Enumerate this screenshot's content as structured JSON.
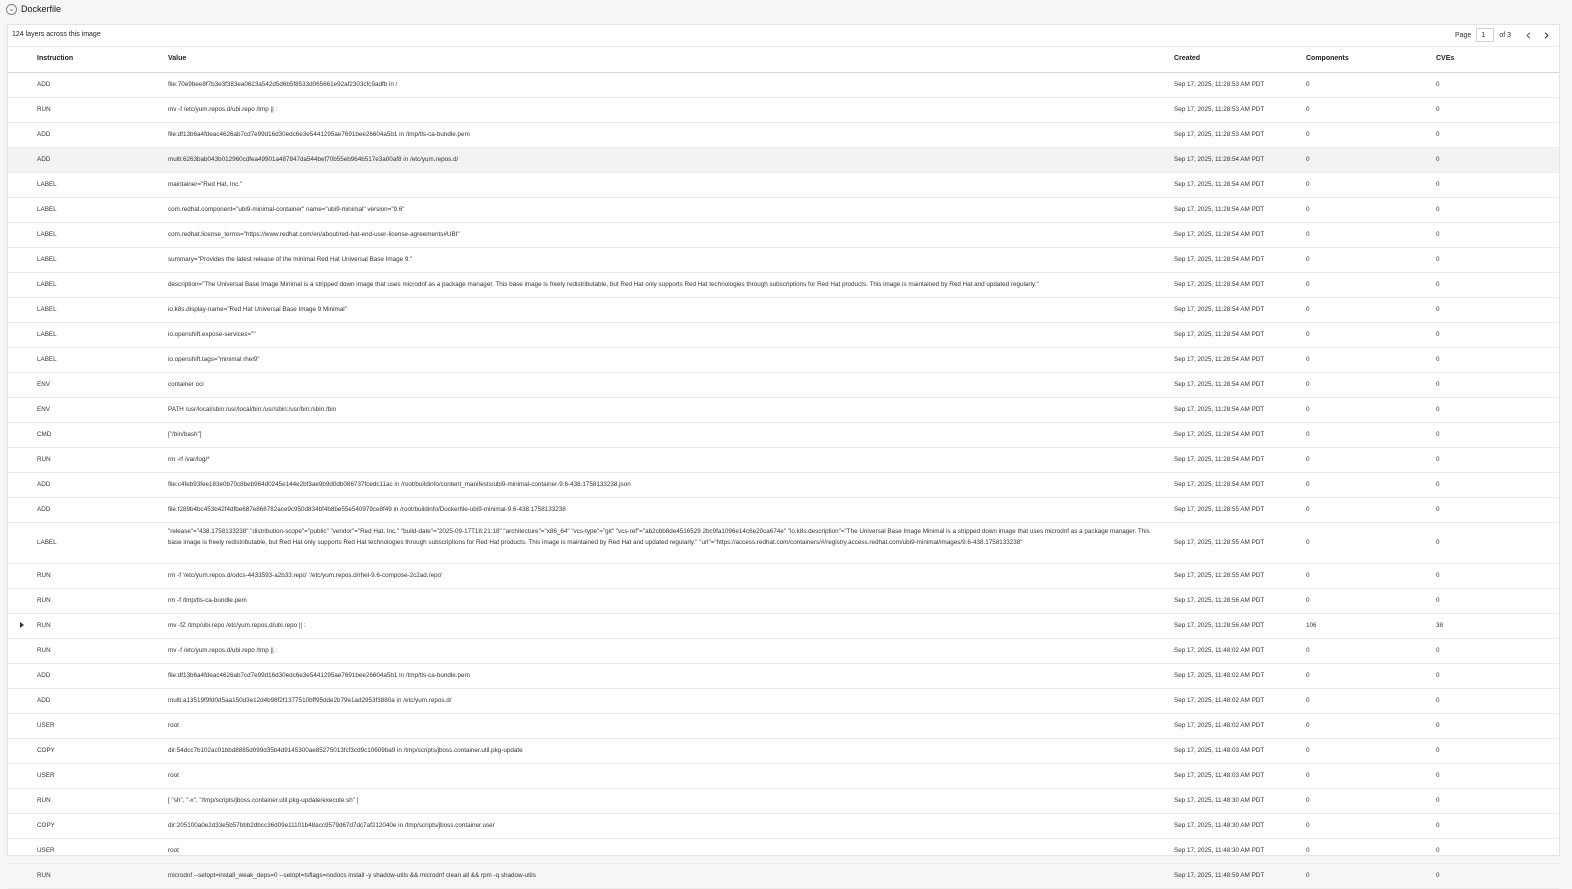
{
  "section": {
    "title": "Dockerfile",
    "toggle_icon": "chevron-down-icon"
  },
  "toolbar": {
    "layer_count": "124 layers across this image",
    "page_label": "Page",
    "page_value": "1",
    "page_total": "of 3"
  },
  "columns": {
    "instruction": "Instruction",
    "value": "Value",
    "created": "Created",
    "components": "Components",
    "cves": "CVEs"
  },
  "rows": [
    {
      "instruction": "ADD",
      "value": "file:70e9bee8f7b3e3f383ea0623a542d5d6b5f8533d065661e92af2303cfc9adfb in /",
      "created": "Sep 17, 2025, 11:28:53 AM PDT",
      "components": "0",
      "cves": "0"
    },
    {
      "instruction": "RUN",
      "value": "mv -f /etc/yum.repos.d/ubi.repo /tmp || :",
      "created": "Sep 17, 2025, 11:28:53 AM PDT",
      "components": "0",
      "cves": "0"
    },
    {
      "instruction": "ADD",
      "value": "file:df13b6a4fdeac4626ab7cd7e99d16d30edc6e3e5441295ae7691bee26604a5b1 in /tmp/tls-ca-bundle.pem",
      "created": "Sep 17, 2025, 11:28:53 AM PDT",
      "components": "0",
      "cves": "0"
    },
    {
      "instruction": "ADD",
      "value": "multi:6263bab043b012960cdfea49901a487847da544bef70b55eb964b517e3a00af8 in /etc/yum.repos.d/",
      "created": "Sep 17, 2025, 11:28:54 AM PDT",
      "components": "0",
      "cves": "0",
      "highlight": true
    },
    {
      "instruction": "LABEL",
      "value": "maintainer=\"Red Hat, Inc.\"",
      "created": "Sep 17, 2025, 11:28:54 AM PDT",
      "components": "0",
      "cves": "0"
    },
    {
      "instruction": "LABEL",
      "value": "com.redhat.component=\"ubi9-minimal-container\" name=\"ubi9-minimal\" version=\"9.6\"",
      "created": "Sep 17, 2025, 11:28:54 AM PDT",
      "components": "0",
      "cves": "0"
    },
    {
      "instruction": "LABEL",
      "value": "com.redhat.license_terms=\"https://www.redhat.com/en/about/red-hat-end-user-license-agreements#UBI\"",
      "created": "Sep 17, 2025, 11:28:54 AM PDT",
      "components": "0",
      "cves": "0"
    },
    {
      "instruction": "LABEL",
      "value": "summary=\"Provides the latest release of the minimal Red Hat Universal Base Image 9.\"",
      "created": "Sep 17, 2025, 11:28:54 AM PDT",
      "components": "0",
      "cves": "0"
    },
    {
      "instruction": "LABEL",
      "value": "description=\"The Universal Base Image Minimal is a stripped down image that uses microdnf as a package manager. This base image is freely redistributable, but Red Hat only supports Red Hat technologies through subscriptions for Red Hat products. This image is maintained by Red Hat and updated regularly.\"",
      "created": "Sep 17, 2025, 11:28:54 AM PDT",
      "components": "0",
      "cves": "0"
    },
    {
      "instruction": "LABEL",
      "value": "io.k8s.display-name=\"Red Hat Universal Base Image 9 Minimal\"",
      "created": "Sep 17, 2025, 11:28:54 AM PDT",
      "components": "0",
      "cves": "0"
    },
    {
      "instruction": "LABEL",
      "value": "io.openshift.expose-services=\"\"",
      "created": "Sep 17, 2025, 11:28:54 AM PDT",
      "components": "0",
      "cves": "0"
    },
    {
      "instruction": "LABEL",
      "value": "io.openshift.tags=\"minimal rhel9\"",
      "created": "Sep 17, 2025, 11:28:54 AM PDT",
      "components": "0",
      "cves": "0"
    },
    {
      "instruction": "ENV",
      "value": "container oci",
      "created": "Sep 17, 2025, 11:28:54 AM PDT",
      "components": "0",
      "cves": "0"
    },
    {
      "instruction": "ENV",
      "value": "PATH /usr/local/sbin:/usr/local/bin:/usr/sbin:/usr/bin:/sbin:/bin",
      "created": "Sep 17, 2025, 11:28:54 AM PDT",
      "components": "0",
      "cves": "0"
    },
    {
      "instruction": "CMD",
      "value": "[\"/bin/bash\"]",
      "created": "Sep 17, 2025, 11:28:54 AM PDT",
      "components": "0",
      "cves": "0"
    },
    {
      "instruction": "RUN",
      "value": "rm -rf /var/log/*",
      "created": "Sep 17, 2025, 11:28:54 AM PDT",
      "components": "0",
      "cves": "0"
    },
    {
      "instruction": "ADD",
      "value": "file:c4feb93fee183e0b70c8beb964d0245e144e2bf3ae9b9d0db086737fcedc11ac in /root/buildinfo/content_manifests/ubi9-minimal-container-9.6-438.1758133238.json",
      "created": "Sep 17, 2025, 11:28:54 AM PDT",
      "components": "0",
      "cves": "0"
    },
    {
      "instruction": "ADD",
      "value": "file:f289b4bc453b42f4dfbe687e866782ace9c950d834bf4b8be55e540979ce8f49 in /root/buildinfo/Dockerfile-ubi9-minimal-9.6-438.1758133238",
      "created": "Sep 17, 2025, 11:28:55 AM PDT",
      "components": "0",
      "cves": "0"
    },
    {
      "instruction": "LABEL",
      "value": "\"release\"=\"438.1758133238\" \"distribution-scope\"=\"public\" \"vendor\"=\"Red Hat, Inc.\" \"build-date\"=\"2025-09-17T18:21:18\" \"architecture\"=\"x86_64\" \"vcs-type\"=\"git\" \"vcs-ref\"=\"ab2cbb8de4516529 2bc9fa1096e14c6e20ca674e\" \"io.k8s.description\"=\"The Universal Base Image Minimal is a stripped down image that uses microdnf as a package manager. This base image is freely redistributable, but Red Hat only supports Red Hat technologies through subscriptions for Red Hat products. This image is maintained by Red Hat and updated regularly.\" \"url\"=\"https://access.redhat.com/containers/#/registry.access.redhat.com/ubi9-minimal/images/9.6-438.1758133238\"",
      "created": "Sep 17, 2025, 11:28:55 AM PDT",
      "components": "0",
      "cves": "0",
      "tall": true
    },
    {
      "instruction": "RUN",
      "value": "rm -f '/etc/yum.repos.d/odcs-4433593-a2b33.repo' '/etc/yum.repos.d/rhel-9.6-compose-2c2ad.repo'",
      "created": "Sep 17, 2025, 11:28:55 AM PDT",
      "components": "0",
      "cves": "0"
    },
    {
      "instruction": "RUN",
      "value": "rm -f /tmp/tls-ca-bundle.pem",
      "created": "Sep 17, 2025, 11:28:56 AM PDT",
      "components": "0",
      "cves": "0"
    },
    {
      "instruction": "RUN",
      "value": "mv -fZ /tmp/ubi.repo /etc/yum.repos.d/ubi.repo || :",
      "created": "Sep 17, 2025, 11:28:56 AM PDT",
      "components": "106",
      "cves": "38",
      "expandable": true
    },
    {
      "instruction": "RUN",
      "value": "mv -f /etc/yum.repos.d/ubi.repo /tmp || :",
      "created": "Sep 17, 2025, 11:48:02 AM PDT",
      "components": "0",
      "cves": "0"
    },
    {
      "instruction": "ADD",
      "value": "file:df13b6a4fdeac4626ab7cd7e99d16d30edc6e3e5441295ae7691bee26604a5b1 in /tmp/tls-ca-bundle.pem",
      "created": "Sep 17, 2025, 11:48:02 AM PDT",
      "components": "0",
      "cves": "0"
    },
    {
      "instruction": "ADD",
      "value": "multi:a13519f9fd0d5aa150d3e12d4b98f2f1377510bff95dde2b79e1ad2953f3880a in /etc/yum.repos.d/",
      "created": "Sep 17, 2025, 11:48:02 AM PDT",
      "components": "0",
      "cves": "0"
    },
    {
      "instruction": "USER",
      "value": "root",
      "created": "Sep 17, 2025, 11:48:02 AM PDT",
      "components": "0",
      "cves": "0"
    },
    {
      "instruction": "COPY",
      "value": "dir:54dcc7b102ac01bbd8885d099d35b4d9145300ae85275013fcf3cd9c10609ba9 in /tmp/scripts/jboss.container.util.pkg-update",
      "created": "Sep 17, 2025, 11:48:03 AM PDT",
      "components": "0",
      "cves": "0"
    },
    {
      "instruction": "USER",
      "value": "root",
      "created": "Sep 17, 2025, 11:48:03 AM PDT",
      "components": "0",
      "cves": "0"
    },
    {
      "instruction": "RUN",
      "value": "[ \"sh\", \"-x\", \"/tmp/scripts/jboss.container.util.pkg-update/execute.sh\" ]",
      "created": "Sep 17, 2025, 11:48:30 AM PDT",
      "components": "0",
      "cves": "0"
    },
    {
      "instruction": "COPY",
      "value": "dir:205100a0e2d33e5b57bbb2dbcc36d09e11101b48acc9579d67d7dc7af212040e in /tmp/scripts/jboss.container.user",
      "created": "Sep 17, 2025, 11:48:30 AM PDT",
      "components": "0",
      "cves": "0"
    },
    {
      "instruction": "USER",
      "value": "root",
      "created": "Sep 17, 2025, 11:48:30 AM PDT",
      "components": "0",
      "cves": "0"
    },
    {
      "instruction": "RUN",
      "value": "microdnf --setopt=install_weak_deps=0 --setopt=tsflags=nodocs install -y shadow-utils && microdnf clean all && rpm -q shadow-utils",
      "created": "Sep 17, 2025, 11:48:59 AM PDT",
      "components": "0",
      "cves": "0"
    }
  ]
}
